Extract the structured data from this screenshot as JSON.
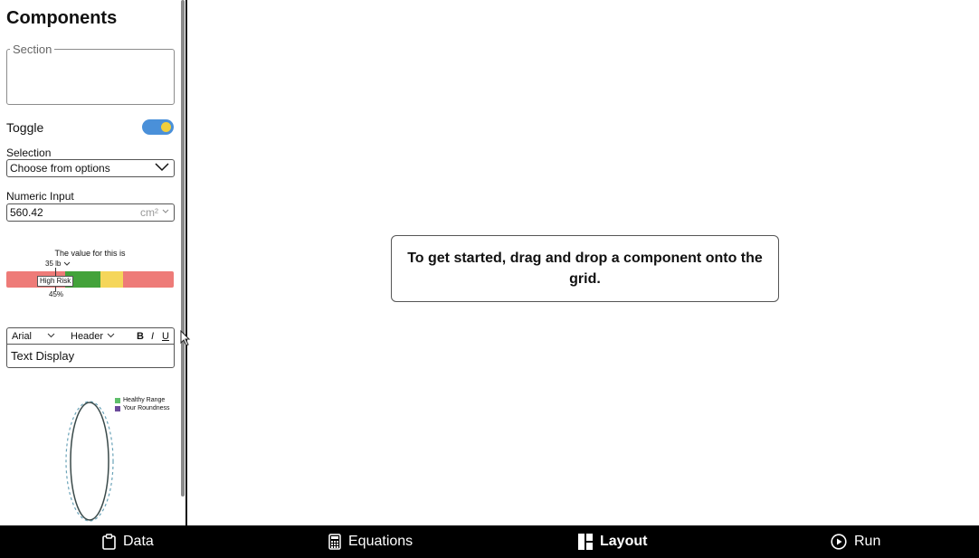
{
  "sidebar": {
    "title": "Components",
    "section": {
      "legend": "Section"
    },
    "toggle": {
      "label": "Toggle",
      "on": true,
      "track_color": "#4a90d9",
      "knob_color": "#f2cf3b"
    },
    "selection": {
      "label": "Selection",
      "value": "Choose from options"
    },
    "numeric_input": {
      "label": "Numeric Input",
      "value": "560.42",
      "unit": "cm²"
    },
    "risk_bar": {
      "caption": "The value for this is",
      "value_label": "35 lb",
      "badge": "High Risk",
      "percent_label": "45%",
      "segment_colors": [
        "#ee7b78",
        "#43a23a",
        "#f5d65a",
        "#ee7b78"
      ]
    },
    "text_display": {
      "font": "Arial",
      "style": "Header",
      "bold": "B",
      "italic": "I",
      "underline": "U",
      "text": "Text Display"
    },
    "roundness_chart": {
      "legend": [
        {
          "label": "Healthy Range",
          "color": "#5fbf6b"
        },
        {
          "label": "Your Roundness",
          "color": "#6b4a9b"
        }
      ]
    }
  },
  "main": {
    "prompt": "To get started, drag and drop a component onto the grid."
  },
  "bottom_nav": {
    "items": [
      {
        "label": "Data",
        "icon": "clipboard-icon",
        "active": false
      },
      {
        "label": "Equations",
        "icon": "calculator-icon",
        "active": false
      },
      {
        "label": "Layout",
        "icon": "layout-icon",
        "active": true
      },
      {
        "label": "Run",
        "icon": "play-circle-icon",
        "active": false
      }
    ]
  }
}
